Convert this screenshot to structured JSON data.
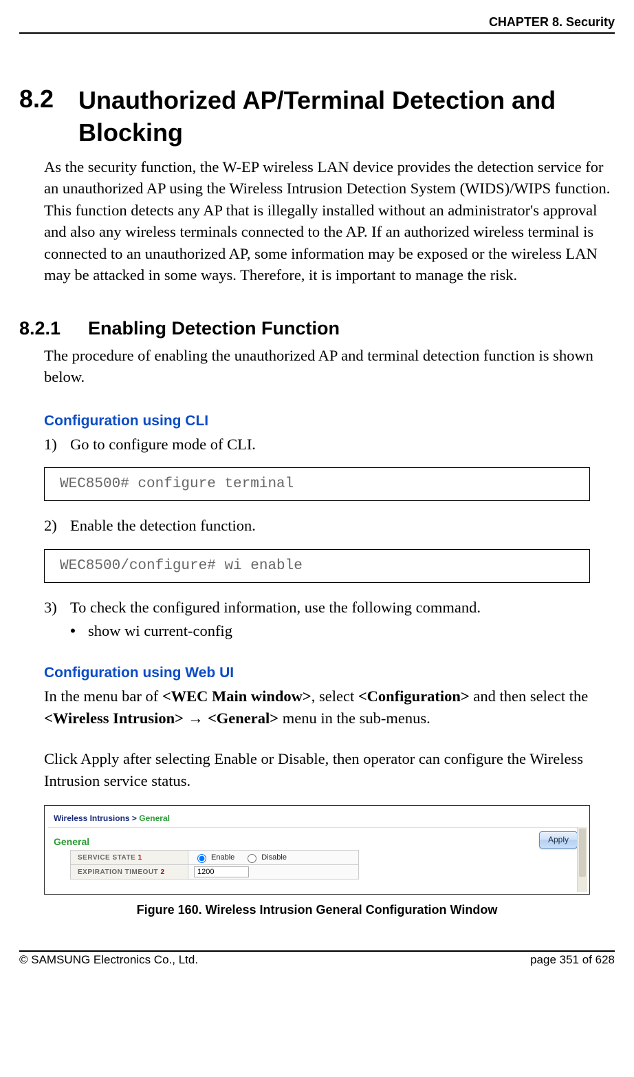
{
  "header": {
    "chapter": "CHAPTER 8. Security"
  },
  "section": {
    "number": "8.2",
    "title": "Unauthorized AP/Terminal Detection and Blocking",
    "intro": "As the security function, the W-EP wireless LAN device provides the detection service for an unauthorized AP using the Wireless Intrusion Detection System (WIDS)/WIPS function. This function detects any AP that is illegally installed without an administrator's approval and also any wireless terminals connected to the AP. If an authorized wireless terminal is connected to an unauthorized AP, some information may be exposed or the wireless LAN may be attacked in some ways. Therefore, it is important to manage the risk."
  },
  "subsection": {
    "number": "8.2.1",
    "title": "Enabling Detection Function",
    "intro": "The procedure of enabling the unauthorized AP and terminal detection function is shown below."
  },
  "cli": {
    "heading": "Configuration using CLI",
    "steps": {
      "s1": {
        "marker": "1)",
        "text": "Go to configure mode of CLI."
      },
      "s2": {
        "marker": "2)",
        "text": "Enable the detection function."
      },
      "s3": {
        "marker": "3)",
        "text": "To check the configured information, use the following command."
      }
    },
    "code1": "WEC8500# configure terminal",
    "code2": "WEC8500/configure# wi enable",
    "bullet": "show  wi  current-config"
  },
  "webui": {
    "heading": "Configuration using Web UI",
    "para1_prefix": "In the menu bar of ",
    "para1_bold1": "<WEC Main window>",
    "para1_mid1": ", select ",
    "para1_bold2": "<Configuration>",
    "para1_mid2": " and then select the ",
    "para1_bold3": "<Wireless Intrusion>",
    "para1_arrow": " → ",
    "para1_bold4": "<General>",
    "para1_suffix": " menu in the sub-menus.",
    "para2": "Click Apply after selecting Enable or Disable, then operator can configure the Wireless Intrusion service status."
  },
  "figure": {
    "breadcrumb_root": "Wireless Intrusions",
    "breadcrumb_sep": "  >  ",
    "breadcrumb_leaf": "General",
    "section_label": "General",
    "row1_label": "SERVICE STATE ",
    "row1_sup": "1",
    "row1_enable": "Enable",
    "row1_disable": "Disable",
    "row2_label": "EXPIRATION TIMEOUT ",
    "row2_sup": "2",
    "row2_value": "1200",
    "apply": "Apply",
    "caption": "Figure 160. Wireless Intrusion General Configuration Window"
  },
  "footer": {
    "copyright": "© SAMSUNG Electronics Co., Ltd.",
    "page": "page 351 of 628"
  }
}
